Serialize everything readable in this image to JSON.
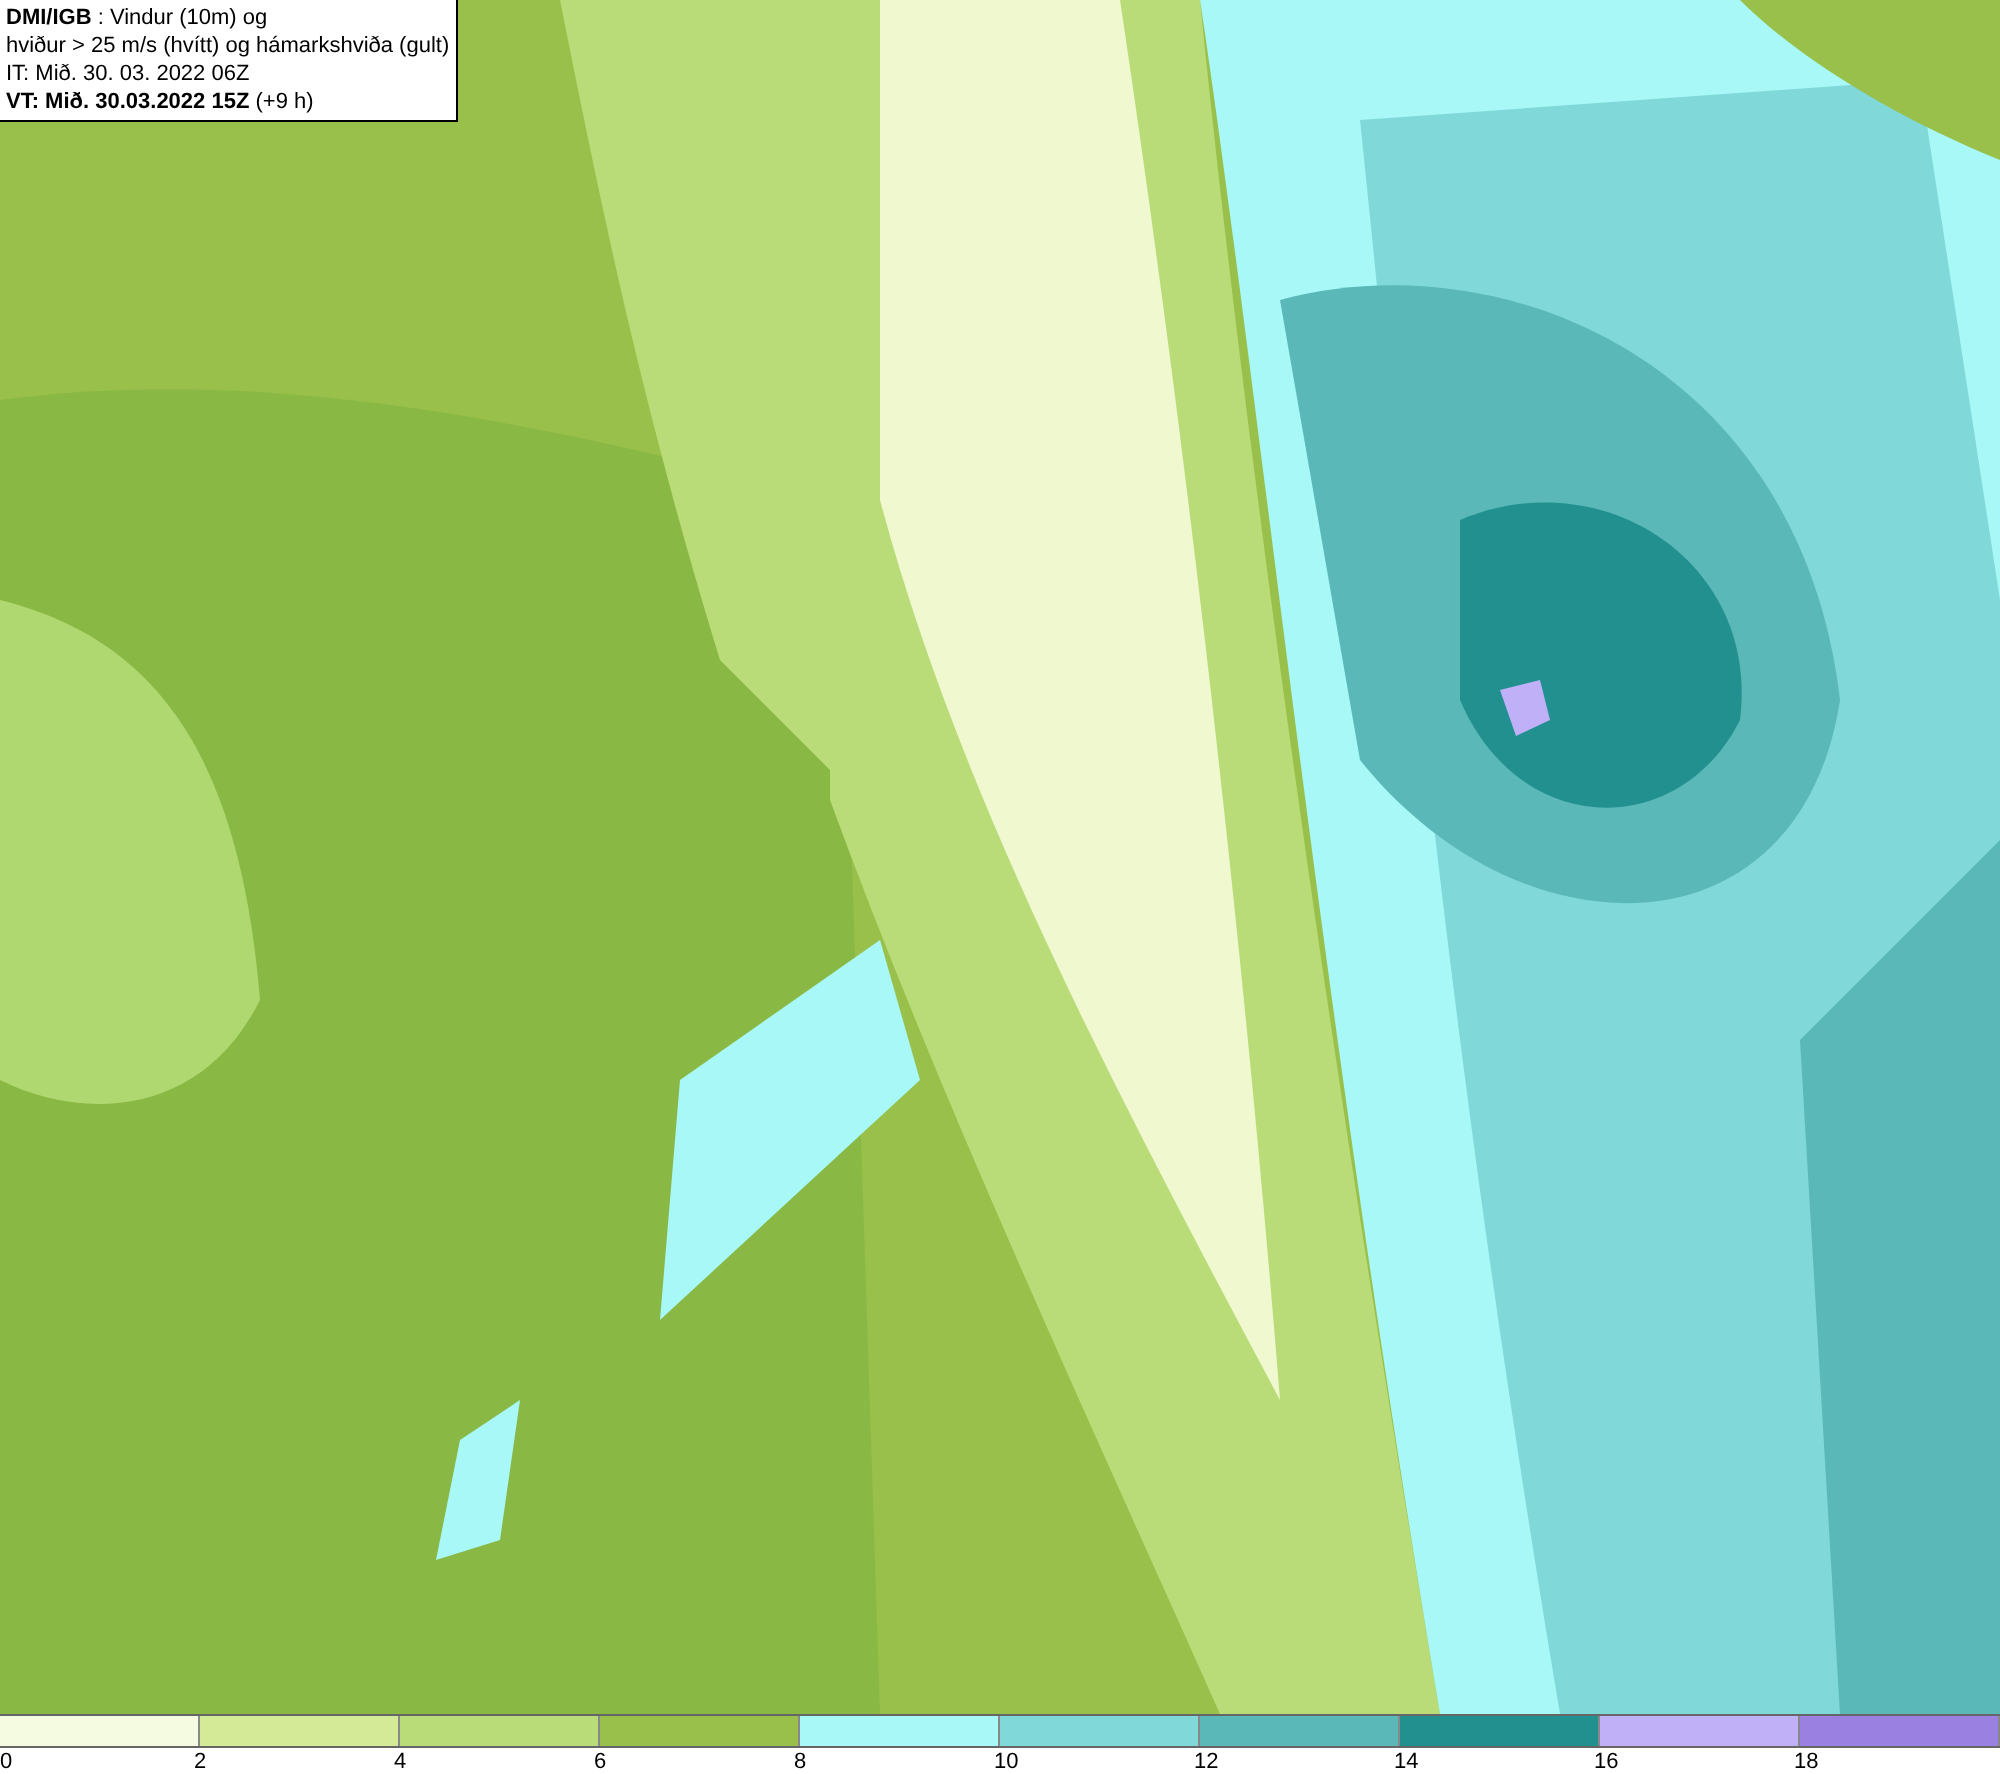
{
  "info_box": {
    "lines": [
      "**DMI/IGB** : Vindur (10m) og",
      "hviður > 25 m/s (hvítt) og hámarkshviða (gult)",
      "IT: Mið. 30. 03. 2022 06Z",
      "**VT: Mið. 30.03.2022 15Z** (+9 h)"
    ]
  },
  "legend": [
    {
      "label": "0",
      "color": "#f5fbe0"
    },
    {
      "label": "2",
      "color": "#d4ea97"
    },
    {
      "label": "4",
      "color": "#b9dc78"
    },
    {
      "label": "6",
      "color": "#98c04a"
    },
    {
      "label": "8",
      "color": "#a8f8f8"
    },
    {
      "label": "10",
      "color": "#80d8d8"
    },
    {
      "label": "12",
      "color": "#5ab8b8"
    },
    {
      "label": "14",
      "color": "#239090"
    },
    {
      "label": "16",
      "color": "#c0b0f8"
    },
    {
      "label": "18",
      "color": "#9a80e0"
    }
  ]
}
